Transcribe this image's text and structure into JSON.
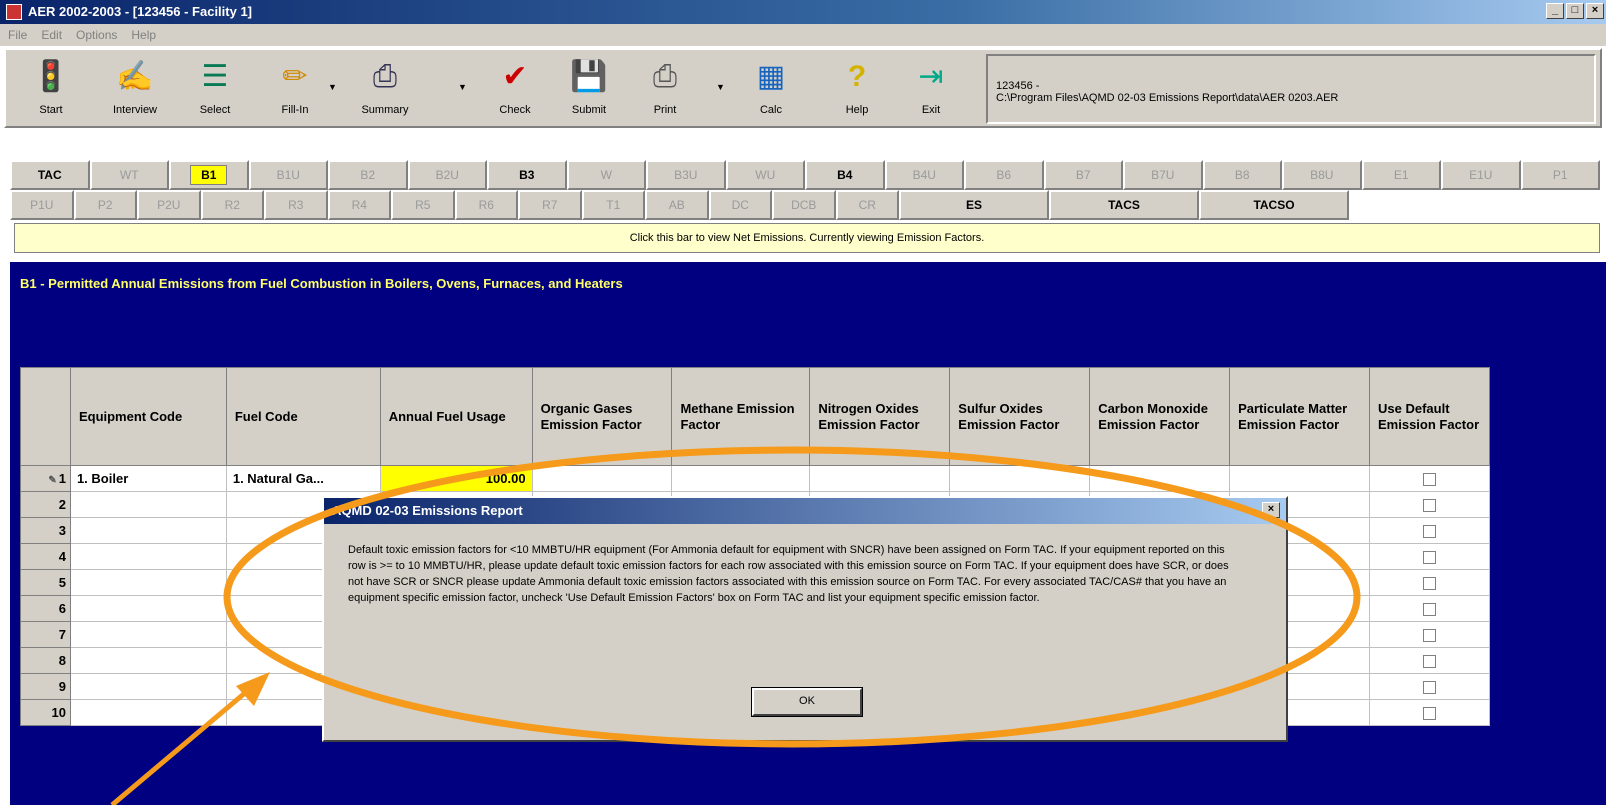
{
  "window": {
    "title": "AER 2002-2003 - [123456 - Facility 1]",
    "controls": [
      "_",
      "□",
      "×"
    ]
  },
  "menu": [
    "File",
    "Edit",
    "Options",
    "Help"
  ],
  "toolbar": {
    "buttons": [
      {
        "label": "Start",
        "icon": "traffic-light-icon",
        "glyph": "🚦"
      },
      {
        "label": "Interview",
        "icon": "interview-icon",
        "glyph": "✍"
      },
      {
        "label": "Select",
        "icon": "select-form-icon",
        "glyph": "☰"
      },
      {
        "label": "Fill-In",
        "icon": "pencil-icon",
        "glyph": "✏"
      },
      {
        "label": "Summary",
        "icon": "summary-icon",
        "glyph": "⎙"
      },
      {
        "label": "Check",
        "icon": "check-icon",
        "glyph": "✔"
      },
      {
        "label": "Submit",
        "icon": "floppy-disk-icon",
        "glyph": "💾"
      },
      {
        "label": "Print",
        "icon": "printer-icon",
        "glyph": "⎙"
      },
      {
        "label": "Calc",
        "icon": "calculator-icon",
        "glyph": "▦"
      },
      {
        "label": "Help",
        "icon": "help-icon",
        "glyph": "?"
      },
      {
        "label": "Exit",
        "icon": "exit-door-icon",
        "glyph": "⇥"
      }
    ],
    "path_line1": "123456 -",
    "path_line2": "C:\\Program Files\\AQMD 02-03 Emissions Report\\data\\AER 0203.AER"
  },
  "tabs": {
    "row1": [
      {
        "label": "TAC",
        "state": "active"
      },
      {
        "label": "WT",
        "state": "disabled"
      },
      {
        "label": "B1",
        "state": "selected"
      },
      {
        "label": "B1U",
        "state": "disabled"
      },
      {
        "label": "B2",
        "state": "disabled"
      },
      {
        "label": "B2U",
        "state": "disabled"
      },
      {
        "label": "B3",
        "state": "active"
      },
      {
        "label": "W",
        "state": "disabled"
      },
      {
        "label": "B3U",
        "state": "disabled"
      },
      {
        "label": "WU",
        "state": "disabled"
      },
      {
        "label": "B4",
        "state": "active"
      },
      {
        "label": "B4U",
        "state": "disabled"
      },
      {
        "label": "B6",
        "state": "disabled"
      },
      {
        "label": "B7",
        "state": "disabled"
      },
      {
        "label": "B7U",
        "state": "disabled"
      },
      {
        "label": "B8",
        "state": "disabled"
      },
      {
        "label": "B8U",
        "state": "disabled"
      },
      {
        "label": "E1",
        "state": "disabled"
      },
      {
        "label": "E1U",
        "state": "disabled"
      },
      {
        "label": "P1",
        "state": "disabled"
      }
    ],
    "row2": [
      {
        "label": "P1U",
        "state": "disabled"
      },
      {
        "label": "P2",
        "state": "disabled"
      },
      {
        "label": "P2U",
        "state": "disabled"
      },
      {
        "label": "R2",
        "state": "disabled"
      },
      {
        "label": "R3",
        "state": "disabled"
      },
      {
        "label": "R4",
        "state": "disabled"
      },
      {
        "label": "R5",
        "state": "disabled"
      },
      {
        "label": "R6",
        "state": "disabled"
      },
      {
        "label": "R7",
        "state": "disabled"
      },
      {
        "label": "T1",
        "state": "disabled"
      },
      {
        "label": "AB",
        "state": "disabled"
      },
      {
        "label": "DC",
        "state": "disabled"
      },
      {
        "label": "DCB",
        "state": "disabled"
      },
      {
        "label": "CR",
        "state": "disabled"
      },
      {
        "label": "ES",
        "state": "active"
      },
      {
        "label": "TACS",
        "state": "active"
      },
      {
        "label": "TACSO",
        "state": "active"
      }
    ]
  },
  "infobar": "Click this bar to view Net Emissions. Currently viewing Emission Factors.",
  "form": {
    "title": "B1 - Permitted Annual Emissions from Fuel Combustion in Boilers, Ovens, Furnaces, and Heaters",
    "columns": [
      "Equipment Code",
      "Fuel Code",
      "Annual Fuel Usage",
      "Organic Gases Emission Factor",
      "Methane Emission Factor",
      "Nitrogen Oxides Emission Factor",
      "Sulfur Oxides Emission Factor",
      "Carbon Monoxide Emission Factor",
      "Particulate Matter Emission Factor",
      "Use Default Emission Factor"
    ],
    "rows": [
      {
        "n": "1",
        "equipment": "1. Boiler",
        "fuel": "1. Natural Ga...",
        "usage": "100.00"
      },
      {
        "n": "2",
        "equipment": "",
        "fuel": "",
        "usage": ""
      },
      {
        "n": "3",
        "equipment": "",
        "fuel": "",
        "usage": ""
      },
      {
        "n": "4",
        "equipment": "",
        "fuel": "",
        "usage": ""
      },
      {
        "n": "5",
        "equipment": "",
        "fuel": "",
        "usage": ""
      },
      {
        "n": "6",
        "equipment": "",
        "fuel": "",
        "usage": ""
      },
      {
        "n": "7",
        "equipment": "",
        "fuel": "",
        "usage": ""
      },
      {
        "n": "8",
        "equipment": "",
        "fuel": "",
        "usage": ""
      },
      {
        "n": "9",
        "equipment": "",
        "fuel": "",
        "usage": ""
      },
      {
        "n": "10",
        "equipment": "",
        "fuel": "",
        "usage": ""
      }
    ]
  },
  "dialog": {
    "title": "AQMD 02-03 Emissions Report",
    "message": "Default toxic emission factors for <10 MMBTU/HR equipment (For Ammonia default for equipment with SNCR) have been assigned on Form TAC. If your equipment reported on this row is >= to 10 MMBTU/HR, please update default toxic emission factors for each row associated with this emission source on Form TAC. If your equipment does have SCR, or does not have SCR or SNCR please update Ammonia default toxic emission factors associated with this emission source on Form TAC. For every associated TAC/CAS# that you have an equipment specific emission factor, uncheck 'Use Default Emission Factors' box on Form TAC and list your equipment specific emission factor.",
    "ok_label": "OK",
    "close_label": "×"
  },
  "colors": {
    "panel": "#000080",
    "highlight": "#ffff00",
    "annotation": "#f59a1b"
  }
}
